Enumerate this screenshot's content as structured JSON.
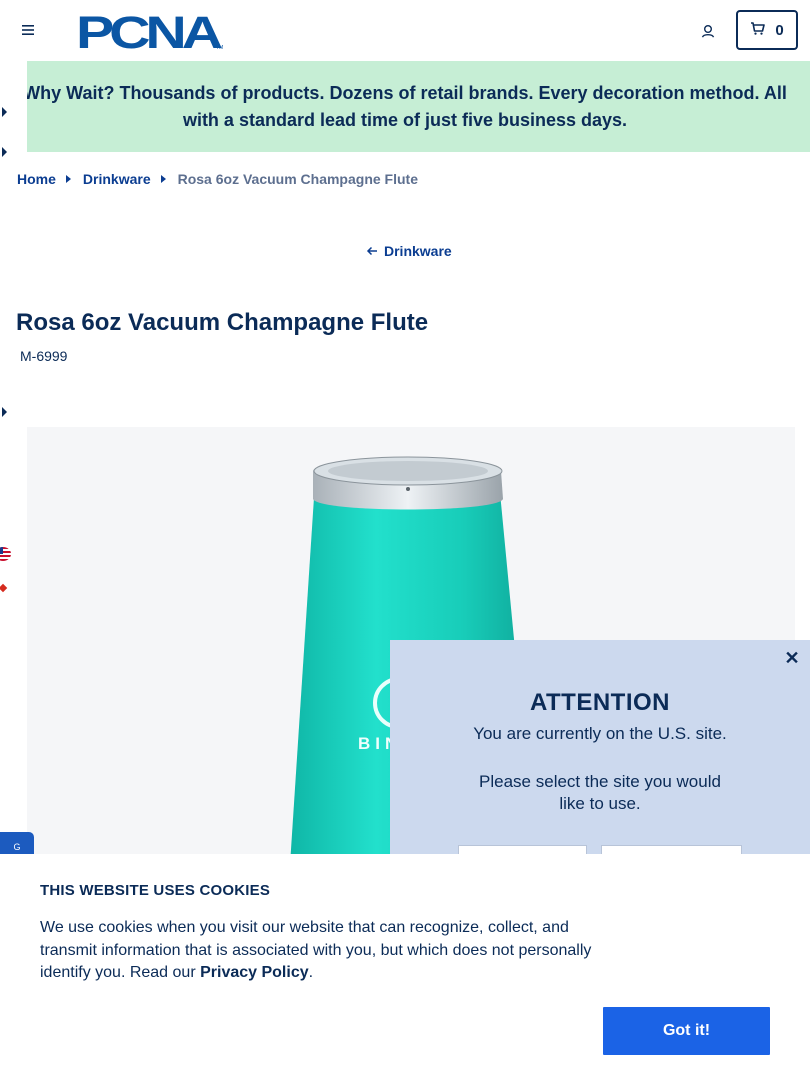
{
  "header": {
    "logo_text": "PCNA",
    "cart_count": "0"
  },
  "promo": {
    "text": "Why Wait? Thousands of products. Dozens of retail brands. Every decoration method. All with a standard lead time of just five business days."
  },
  "breadcrumb": {
    "items": [
      "Home",
      "Drinkware"
    ],
    "current": "Rosa 6oz Vacuum Champagne Flute"
  },
  "back_link": "Drinkware",
  "product": {
    "title": "Rosa 6oz Vacuum Champagne Flute",
    "sku": "M-6999",
    "image_brand_text": "BINX",
    "product_color": "#19d8c4"
  },
  "attention": {
    "close": "✕",
    "title": "ATTENTION",
    "message": "You are currently on the U.S. site.",
    "prompt": "Please select the site you would like to use."
  },
  "cookie": {
    "title": "THIS WEBSITE USES COOKIES",
    "body": "We use cookies when you visit our website that can recognize, collect, and transmit information that is associated with you, but which does not personally identify you. Read our ",
    "link": "Privacy Policy",
    "period": ".",
    "button": "Got it!"
  },
  "feedback_tab": "G",
  "colors": {
    "navy": "#0b2b57",
    "promo_bg": "#c6eed5",
    "accent_blue": "#1b63e6",
    "modal_bg": "#ccd9ee"
  }
}
